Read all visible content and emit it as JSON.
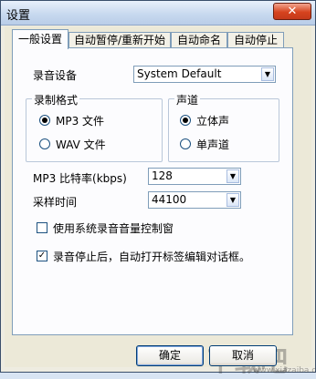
{
  "window": {
    "title": "设置",
    "close_glyph": "✕"
  },
  "tabs": [
    {
      "label": "一般设置",
      "active": true
    },
    {
      "label": "自动暂停/重新开始",
      "active": false
    },
    {
      "label": "自动命名",
      "active": false
    },
    {
      "label": "自动停止",
      "active": false
    }
  ],
  "recording_device": {
    "label": "录音设备",
    "value": "System Default"
  },
  "format_group": {
    "title": "录制格式",
    "options": [
      {
        "label": "MP3 文件",
        "selected": true
      },
      {
        "label": "WAV 文件",
        "selected": false
      }
    ]
  },
  "channel_group": {
    "title": "声道",
    "options": [
      {
        "label": "立体声",
        "selected": true
      },
      {
        "label": "单声道",
        "selected": false
      }
    ]
  },
  "bitrate": {
    "label": "MP3 比特率(kbps)",
    "value": "128"
  },
  "sample_rate": {
    "label": "采样时间",
    "value": "44100"
  },
  "checkboxes": [
    {
      "label": "使用系统录音音量控制窗",
      "checked": false
    },
    {
      "label": "录音停止后，自动打开标签编辑对话框。",
      "checked": true
    }
  ],
  "buttons": {
    "ok": "确定",
    "cancel": "取消"
  },
  "watermark": {
    "text": "下载吧",
    "url": "www.xiazaiba.com"
  },
  "icons": {
    "combo_arrow": "▼",
    "check_mark": "✓"
  },
  "colors": {
    "tab_border": "#7f9db9",
    "panel_bg": "#fcfcfe",
    "dialog_bg": "#ece9d8"
  }
}
